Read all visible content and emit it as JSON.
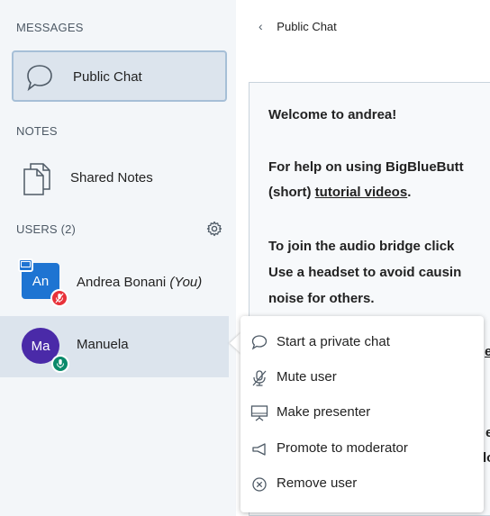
{
  "sidebar": {
    "messages_title": "MESSAGES",
    "public_chat_label": "Public Chat",
    "notes_title": "NOTES",
    "shared_notes_label": "Shared Notes",
    "users_title": "USERS (2)",
    "users": [
      {
        "initials": "An",
        "name": "Andrea Bonani",
        "suffix": "(You)",
        "avatar_color": "#1e74d2",
        "mic_state": "muted",
        "mic_color": "#e8313a",
        "presenter": true
      },
      {
        "initials": "Ma",
        "name": "Manuela",
        "suffix": "",
        "avatar_color": "#4a2aa8",
        "mic_state": "unmuted",
        "mic_color": "#0b8a6b",
        "presenter": false
      }
    ]
  },
  "chat": {
    "back_icon": "‹",
    "title": "Public Chat",
    "welcome_prefix": "Welcome to ",
    "welcome_name": "andrea",
    "welcome_suffix": "!",
    "help_line1": "For help on using BigBlueButt",
    "help_line2_prefix": "(short) ",
    "help_line2_link": "tutorial videos",
    "help_line2_suffix": ".",
    "audio_line1": "To join the audio bridge click",
    "audio_line2": "Use a headset to avoid causin",
    "audio_line3": "noise for others.",
    "partial_1": "e",
    "partial_2": "e",
    "partial_3": "lo"
  },
  "context_menu": {
    "items": [
      {
        "label": "Start a private chat",
        "icon": "chat-bubble-icon"
      },
      {
        "label": "Mute user",
        "icon": "mic-muted-icon"
      },
      {
        "label": "Make presenter",
        "icon": "presentation-icon"
      },
      {
        "label": "Promote to moderator",
        "icon": "megaphone-icon"
      },
      {
        "label": "Remove user",
        "icon": "close-circle-icon"
      }
    ]
  }
}
